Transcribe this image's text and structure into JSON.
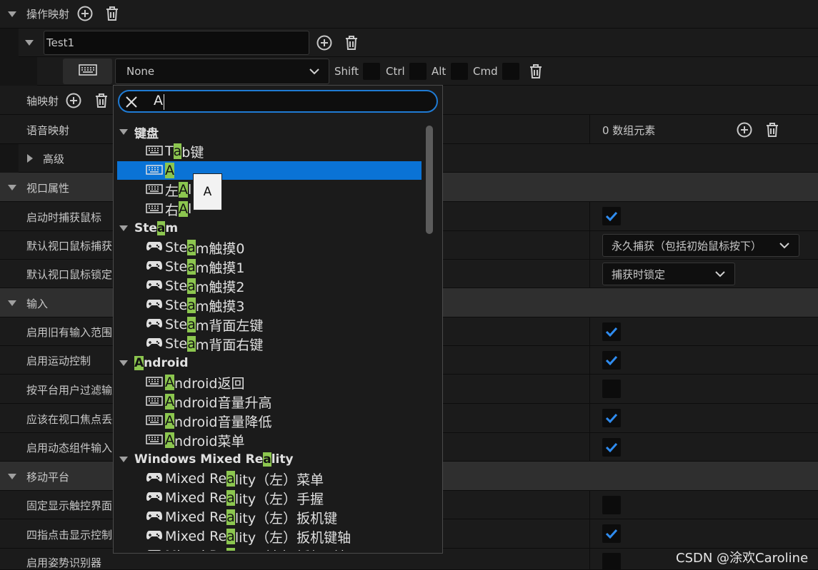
{
  "colors": {
    "accent": "#0a73d6",
    "highlight": "#8cc64f",
    "category_bg": "#2f2f2f",
    "row_bg": "#1b1b1b"
  },
  "action_mappings": {
    "label": "操作映射",
    "mapping_name": "Test1",
    "key_value": "None",
    "modifiers": {
      "shift": "Shift",
      "ctrl": "Ctrl",
      "alt": "Alt",
      "cmd": "Cmd"
    }
  },
  "axis_mappings": {
    "label": "轴映射"
  },
  "speech_mappings": {
    "label": "语音映射",
    "value": "0 数组元素"
  },
  "advanced": {
    "label": "高级"
  },
  "viewport": {
    "label": "视口属性",
    "capture_mouse_on_launch": "启动时捕获鼠标",
    "default_capture_mode": "默认视口鼠标捕获",
    "default_capture_mode_value": "永久捕获（包括初始鼠标按下）",
    "default_lock_mode": "默认视口鼠标锁定",
    "default_lock_mode_value": "捕获时锁定"
  },
  "input": {
    "label": "输入",
    "enable_legacy_scale": "启用旧有输入范围",
    "enable_motion": "启用运动控制",
    "filter_by_platform": "按平台用户过滤输入",
    "flush_on_focus_loss": "应该在视口焦点丢失",
    "dynamic_component": "启用动态组件输入"
  },
  "mobile": {
    "label": "移动平台",
    "always_show_touch": "固定显示触控界面",
    "four_finger_tap": "四指点击显示控制台",
    "gesture_recognizer": "启用姿势识别器"
  },
  "search": {
    "query": "A"
  },
  "tooltip": {
    "text": "A"
  },
  "watermark": "CSDN @涂欢Caroline"
}
